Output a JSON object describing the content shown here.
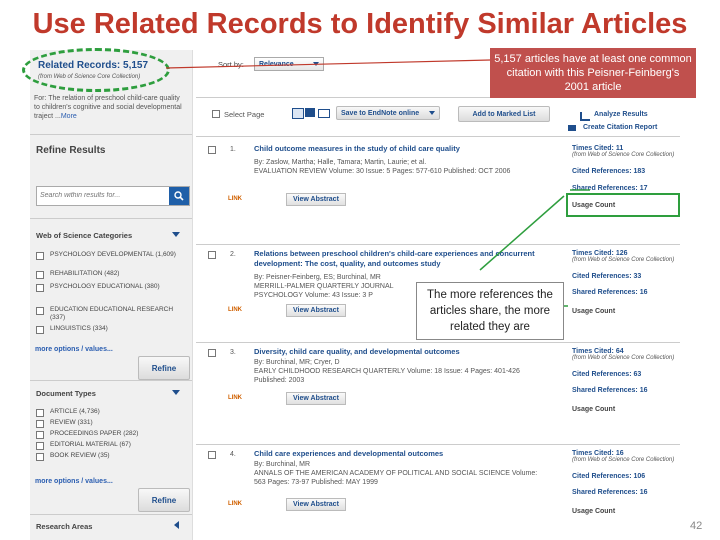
{
  "slide_title": "Use Related Records to Identify Similar Articles",
  "page_number": "42",
  "callout_top": "5,157 articles have at least one common citation with this Peisner-Feinberg's 2001 article",
  "callout_mid": "The more references the articles share, the more related they are",
  "colors": {
    "accent": "#c0392b",
    "link": "#1f4e8c",
    "callout": "#c0504d",
    "green_highlight": "#2e9e3e"
  },
  "sidebar": {
    "related_title": "Related Records: 5,157",
    "related_source": "(from Web of Science Core Collection)",
    "for_text": "For: The relation of preschool child-care quality to children's cognitive and social developmental traject ...",
    "more": "More",
    "refine_results": "Refine Results",
    "search_placeholder": "Search within results for...",
    "categories_title": "Web of Science Categories",
    "categories": [
      "PSYCHOLOGY DEVELOPMENTAL (1,609)",
      "REHABILITATION (482)",
      "PSYCHOLOGY EDUCATIONAL (380)",
      "EDUCATION EDUCATIONAL RESEARCH (337)",
      "LINGUISTICS (334)"
    ],
    "more_options": "more options / values...",
    "refine": "Refine",
    "doc_types_title": "Document Types",
    "doc_types": [
      "ARTICLE (4,736)",
      "REVIEW (331)",
      "PROCEEDINGS PAPER (282)",
      "EDITORIAL MATERIAL (67)",
      "BOOK REVIEW (35)"
    ],
    "research_areas": "Research Areas"
  },
  "toolbar": {
    "sort_by": "Sort by:",
    "sort_value": "Relevance",
    "select_page": "Select Page",
    "save_endnote": "Save to EndNote online",
    "add_marked": "Add to Marked List",
    "analyze": "Analyze Results",
    "citation_report": "Create Citation Report"
  },
  "records": [
    {
      "num": "1.",
      "title": "Child outcome measures in the study of child care quality",
      "body": "By: Zaslow, Martha; Halle, Tamara; Martin, Laurie; et al.\nEVALUATION REVIEW Volume: 30 Issue: 5 Pages: 577-610 Published: OCT 2006",
      "view_abstract": "View Abstract",
      "times_cited": "Times Cited: 11",
      "tc_source": "(from Web of Science Core Collection)",
      "cited_refs": "Cited References: 183",
      "shared_refs": "Shared References: 17",
      "usage": "Usage Count"
    },
    {
      "num": "2.",
      "title": "Relations between preschool children's child-care experiences and concurrent development: The cost, quality, and outcomes study",
      "body": "By: Peisner-Feinberg, ES; Burchinal, MR\nMERRILL-PALMER QUARTERLY JOURNAL\nPSYCHOLOGY Volume: 43 Issue: 3 P",
      "view_abstract": "View Abstract",
      "times_cited": "Times Cited: 126",
      "tc_source": "(from Web of Science Core Collection)",
      "cited_refs": "Cited References: 33",
      "shared_refs": "Shared References: 16",
      "usage": "Usage Count"
    },
    {
      "num": "3.",
      "title": "Diversity, child care quality, and developmental outcomes",
      "body": "By: Burchinal, MR; Cryer, D\nEARLY CHILDHOOD RESEARCH QUARTERLY Volume: 18 Issue: 4 Pages: 401-426 Published: 2003",
      "view_abstract": "View Abstract",
      "times_cited": "Times Cited: 64",
      "tc_source": "(from Web of Science Core Collection)",
      "cited_refs": "Cited References: 63",
      "shared_refs": "Shared References: 16",
      "usage": "Usage Count"
    },
    {
      "num": "4.",
      "title": "Child care experiences and developmental outcomes",
      "body": "By: Burchinal, MR\nANNALS OF THE AMERICAN ACADEMY OF POLITICAL AND SOCIAL SCIENCE Volume: 563 Pages: 73-97 Published: MAY 1999",
      "view_abstract": "View Abstract",
      "times_cited": "Times Cited: 16",
      "tc_source": "(from Web of Science Core Collection)",
      "cited_refs": "Cited References: 106",
      "shared_refs": "Shared References: 16",
      "usage": "Usage Count"
    }
  ],
  "findit": "LINK"
}
